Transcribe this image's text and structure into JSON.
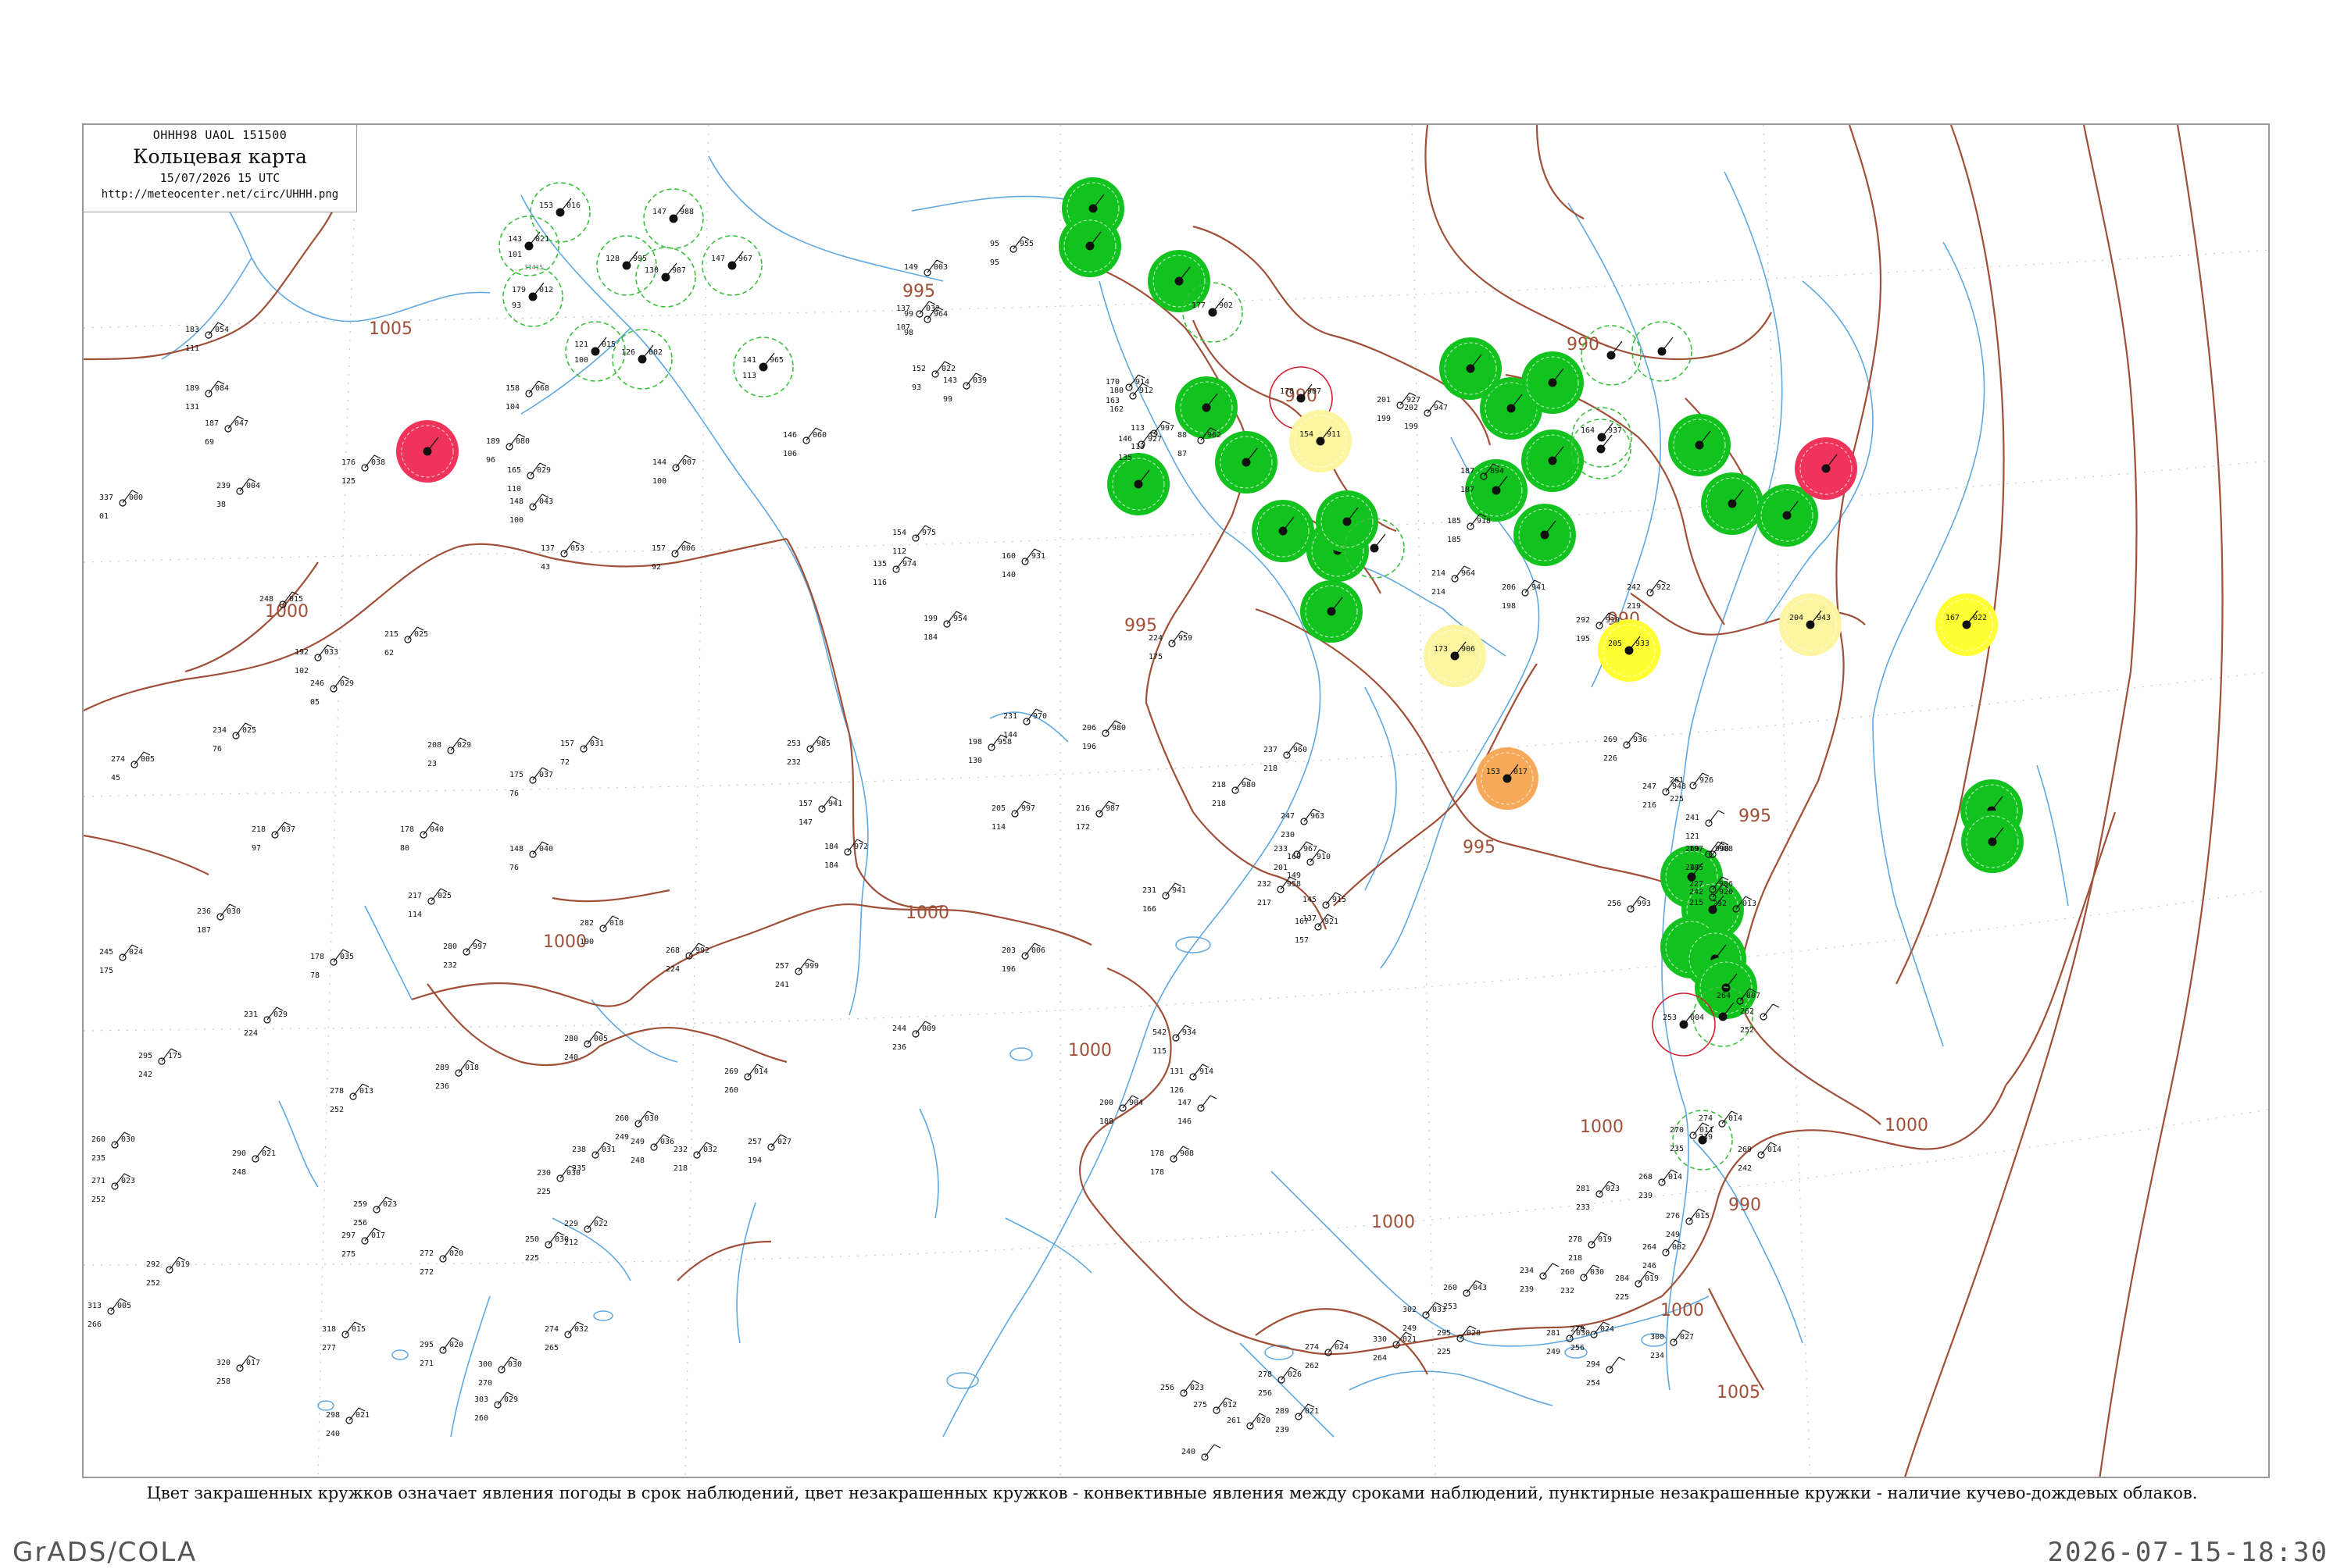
{
  "header": {
    "code": "OHHH98 UAOL 151500",
    "title": "Кольцевая карта",
    "date": "15/07/2026 15 UTC",
    "url": "http://meteocenter.net/circ/UHHH.png"
  },
  "caption": "Цвет закрашенных кружков означает явления погоды в срок наблюдений, цвет незакрашенных кружков - конвективные явления между сроками наблюдений, пунктирные незакрашенные кружки - наличие кучево-дождевых облаков.",
  "footer": {
    "left": "GrADS/COLA",
    "right": "2026-07-15-18:30"
  },
  "colors": {
    "isobar": "#a05038",
    "river": "#5fa8e0",
    "green": "#12c21e",
    "red": "#f0335a",
    "yellow": "#ffff33",
    "light_yellow": "#fdf5a0",
    "orange": "#f7a95a",
    "green_dashed": "#3cbf3c",
    "red_ring": "#d02030"
  },
  "isobar_labels": [
    {
      "text": "1005"
    },
    {
      "text": "1000"
    },
    {
      "text": "1000"
    },
    {
      "text": "1000"
    },
    {
      "text": "1000"
    },
    {
      "text": "1000"
    },
    {
      "text": "1000"
    },
    {
      "text": "995"
    },
    {
      "text": "995"
    },
    {
      "text": "995"
    },
    {
      "text": "995"
    },
    {
      "text": "990"
    },
    {
      "text": "990"
    },
    {
      "text": "990"
    },
    {
      "text": "990"
    },
    {
      "text": "1000"
    },
    {
      "text": "1005"
    },
    {
      "text": "1000"
    }
  ],
  "stations": [
    {
      "t": "143",
      "p": "021",
      "td": "101",
      "id": "31415",
      "kind": "dashed"
    },
    {
      "t": "153",
      "p": "016",
      "td": "",
      "id": "",
      "kind": "dashed"
    },
    {
      "t": "179",
      "p": "012",
      "td": "93",
      "id": "",
      "kind": "dashed"
    },
    {
      "t": "121",
      "p": "015",
      "td": "100",
      "id": "",
      "kind": "dashed"
    },
    {
      "t": "128",
      "p": "995",
      "td": "",
      "id": "",
      "kind": "dashed"
    },
    {
      "t": "147",
      "p": "988",
      "td": "",
      "id": "",
      "kind": "dashed"
    },
    {
      "t": "130",
      "p": "987",
      "td": "",
      "id": "",
      "kind": "dashed"
    },
    {
      "t": "147",
      "p": "967",
      "td": "",
      "id": "",
      "kind": "dashed"
    },
    {
      "t": "126",
      "p": "002",
      "td": "",
      "id": "",
      "kind": "dashed"
    },
    {
      "t": "141",
      "p": "965",
      "td": "113",
      "id": "",
      "kind": "dashed"
    },
    {
      "t": "",
      "p": "",
      "td": "",
      "id": "",
      "kind": "red"
    },
    {
      "t": "",
      "p": "",
      "td": "",
      "id": "",
      "kind": "green"
    },
    {
      "t": "",
      "p": "",
      "td": "",
      "id": "",
      "kind": "green"
    },
    {
      "t": "",
      "p": "",
      "td": "",
      "id": "",
      "kind": "green"
    },
    {
      "t": "",
      "p": "",
      "td": "",
      "id": "",
      "kind": "green"
    },
    {
      "t": "",
      "p": "",
      "td": "",
      "id": "",
      "kind": "green"
    },
    {
      "t": "177",
      "p": "902",
      "td": "",
      "id": "",
      "kind": "dashed"
    },
    {
      "t": "178",
      "p": "907",
      "td": "",
      "id": "",
      "kind": "redring"
    },
    {
      "t": "154",
      "p": "911",
      "td": "",
      "id": "",
      "kind": "lightyellow"
    },
    {
      "t": "",
      "p": "",
      "td": "",
      "id": "",
      "kind": "green"
    },
    {
      "t": "",
      "p": "",
      "td": "",
      "id": "",
      "kind": "green"
    },
    {
      "t": "",
      "p": "",
      "td": "",
      "id": "",
      "kind": "green"
    },
    {
      "t": "",
      "p": "",
      "td": "",
      "id": "",
      "kind": "green"
    },
    {
      "t": "",
      "p": "",
      "td": "",
      "id": "",
      "kind": "green"
    },
    {
      "t": "",
      "p": "",
      "td": "",
      "id": "",
      "kind": "green"
    },
    {
      "t": "",
      "p": "",
      "td": "",
      "id": "",
      "kind": "green"
    },
    {
      "t": "",
      "p": "",
      "td": "",
      "id": "",
      "kind": "green"
    },
    {
      "t": "",
      "p": "",
      "td": "",
      "id": "",
      "kind": "green"
    },
    {
      "t": "",
      "p": "",
      "td": "",
      "id": "",
      "kind": "green"
    },
    {
      "t": "",
      "p": "",
      "td": "",
      "id": "",
      "kind": "green"
    },
    {
      "t": "",
      "p": "",
      "td": "",
      "id": "",
      "kind": "green"
    },
    {
      "t": "",
      "p": "",
      "td": "",
      "id": "",
      "kind": "green"
    },
    {
      "t": "",
      "p": "",
      "td": "",
      "id": "",
      "kind": "red"
    },
    {
      "t": "173",
      "p": "906",
      "td": "",
      "id": "",
      "kind": "lightyellow"
    },
    {
      "t": "204",
      "p": "943",
      "td": "",
      "id": "",
      "kind": "lightyellow"
    },
    {
      "t": "205",
      "p": "933",
      "td": "",
      "id": "",
      "kind": "yellow"
    },
    {
      "t": "167",
      "p": "022",
      "td": "",
      "id": "",
      "kind": "yellow"
    },
    {
      "t": "153",
      "p": "017",
      "td": "",
      "id": "",
      "kind": "orange"
    },
    {
      "t": "",
      "p": "",
      "td": "",
      "id": "",
      "kind": "green"
    },
    {
      "t": "",
      "p": "",
      "td": "",
      "id": "",
      "kind": "green"
    },
    {
      "t": "",
      "p": "",
      "td": "",
      "id": "",
      "kind": "green"
    },
    {
      "t": "",
      "p": "",
      "td": "",
      "id": "",
      "kind": "green"
    },
    {
      "t": "",
      "p": "",
      "td": "",
      "id": "",
      "kind": "green"
    },
    {
      "t": "",
      "p": "",
      "td": "",
      "id": "",
      "kind": "green"
    },
    {
      "t": "",
      "p": "",
      "td": "",
      "id": "",
      "kind": "green"
    },
    {
      "t": "253",
      "p": "004",
      "td": "",
      "id": "",
      "kind": "redring"
    },
    {
      "t": "",
      "p": "",
      "td": "",
      "id": "",
      "kind": "dashed"
    },
    {
      "t": "",
      "p": "",
      "td": "",
      "id": "",
      "kind": "dashed"
    },
    {
      "t": "",
      "p": "",
      "td": "",
      "id": "",
      "kind": "dashed"
    },
    {
      "t": "",
      "p": "",
      "td": "",
      "id": "",
      "kind": "dashed"
    },
    {
      "t": "",
      "p": "",
      "td": "",
      "id": "",
      "kind": "dashed"
    },
    {
      "t": "164",
      "p": "937",
      "td": "",
      "id": "",
      "kind": "dashed"
    },
    {
      "t": "",
      "p": "",
      "td": "",
      "id": "",
      "kind": "dashed"
    },
    {
      "t": "",
      "p": "",
      "td": "",
      "id": "",
      "kind": "green"
    }
  ],
  "plain_stations": [
    {
      "t": "183",
      "p": "054",
      "td": "111"
    },
    {
      "t": "189",
      "p": "084",
      "td": "131"
    },
    {
      "t": "187",
      "p": "047",
      "td": "69"
    },
    {
      "t": "239",
      "p": "004",
      "td": "38"
    },
    {
      "t": "337",
      "p": "000",
      "td": "01"
    },
    {
      "t": "176",
      "p": "038",
      "td": "125"
    },
    {
      "t": "248",
      "p": "015",
      "td": ""
    },
    {
      "t": "246",
      "p": "029",
      "td": "05"
    },
    {
      "t": "274",
      "p": "005",
      "td": "45"
    },
    {
      "t": "234",
      "p": "025",
      "td": "76"
    },
    {
      "t": "218",
      "p": "037",
      "td": "97"
    },
    {
      "t": "236",
      "p": "030",
      "td": "187"
    },
    {
      "t": "245",
      "p": "024",
      "td": "175"
    },
    {
      "t": "178",
      "p": "035",
      "td": "78"
    },
    {
      "t": "231",
      "p": "029",
      "td": "224"
    },
    {
      "t": "295",
      "p": "175",
      "td": "242"
    },
    {
      "t": "278",
      "p": "013",
      "td": "252"
    },
    {
      "t": "260",
      "p": "030",
      "td": "235"
    },
    {
      "t": "290",
      "p": "021",
      "td": "248"
    },
    {
      "t": "271",
      "p": "023",
      "td": "252"
    },
    {
      "t": "297",
      "p": "017",
      "td": "275"
    },
    {
      "t": "292",
      "p": "019",
      "td": "252"
    },
    {
      "t": "313",
      "p": "005",
      "td": "266"
    },
    {
      "t": "318",
      "p": "015",
      "td": "277"
    },
    {
      "t": "320",
      "p": "017",
      "td": "258"
    },
    {
      "t": "298",
      "p": "021",
      "td": "240"
    },
    {
      "t": "259",
      "p": "023",
      "td": "256"
    },
    {
      "t": "272",
      "p": "020",
      "td": "272"
    },
    {
      "t": "295",
      "p": "020",
      "td": "271"
    },
    {
      "t": "303",
      "p": "029",
      "td": "260"
    },
    {
      "t": "300",
      "p": "030",
      "td": "270"
    },
    {
      "t": "274",
      "p": "032",
      "td": "265"
    },
    {
      "t": "250",
      "p": "030",
      "td": "225"
    },
    {
      "t": "229",
      "p": "022",
      "td": "212"
    },
    {
      "t": "230",
      "p": "030",
      "td": "225"
    },
    {
      "t": "238",
      "p": "031",
      "td": "235"
    },
    {
      "t": "249",
      "p": "036",
      "td": "248"
    },
    {
      "t": "260",
      "p": "030",
      "td": "249"
    },
    {
      "t": "232",
      "p": "032",
      "td": "218"
    },
    {
      "t": "257",
      "p": "027",
      "td": "194"
    },
    {
      "t": "269",
      "p": "014",
      "td": "260"
    },
    {
      "t": "244",
      "p": "009",
      "td": "236"
    },
    {
      "t": "289",
      "p": "018",
      "td": "236"
    },
    {
      "t": "280",
      "p": "005",
      "td": "240"
    },
    {
      "t": "280",
      "p": "997",
      "td": "232"
    },
    {
      "t": "268",
      "p": "992",
      "td": "224"
    },
    {
      "t": "257",
      "p": "999",
      "td": "241"
    },
    {
      "t": "203",
      "p": "006",
      "td": "196"
    },
    {
      "t": "217",
      "p": "025",
      "td": "114"
    },
    {
      "t": "282",
      "p": "018",
      "td": "190"
    },
    {
      "t": "178",
      "p": "040",
      "td": "80"
    },
    {
      "t": "148",
      "p": "040",
      "td": "76"
    },
    {
      "t": "175",
      "p": "037",
      "td": "76"
    },
    {
      "t": "208",
      "p": "029",
      "td": "23"
    },
    {
      "t": "157",
      "p": "031",
      "td": "72"
    },
    {
      "t": "215",
      "p": "025",
      "td": "62"
    },
    {
      "t": "192",
      "p": "033",
      "td": "102"
    },
    {
      "t": "137",
      "p": "053",
      "td": "43"
    },
    {
      "t": "165",
      "p": "029",
      "td": "110"
    },
    {
      "t": "144",
      "p": "007",
      "td": "100"
    },
    {
      "t": "157",
      "p": "006",
      "td": "92"
    },
    {
      "t": "154",
      "p": "975",
      "td": "112"
    },
    {
      "t": "135",
      "p": "974",
      "td": "116"
    },
    {
      "t": "160",
      "p": "931",
      "td": "140"
    },
    {
      "t": "199",
      "p": "954",
      "td": "184"
    },
    {
      "t": "231",
      "p": "970",
      "td": "144"
    },
    {
      "t": "198",
      "p": "958",
      "td": "130"
    },
    {
      "t": "206",
      "p": "980",
      "td": "196"
    },
    {
      "t": "205",
      "p": "997",
      "td": "114"
    },
    {
      "t": "216",
      "p": "987",
      "td": "172"
    },
    {
      "t": "253",
      "p": "985",
      "td": "232"
    },
    {
      "t": "157",
      "p": "941",
      "td": "147"
    },
    {
      "t": "184",
      "p": "972",
      "td": "184"
    },
    {
      "t": "224",
      "p": "959",
      "td": "175"
    },
    {
      "t": "218",
      "p": "980",
      "td": "218"
    },
    {
      "t": "237",
      "p": "960",
      "td": "218"
    },
    {
      "t": "231",
      "p": "941",
      "td": "166"
    },
    {
      "t": "232",
      "p": "958",
      "td": "217"
    },
    {
      "t": "247",
      "p": "963",
      "td": "230"
    },
    {
      "t": "233",
      "p": "967",
      "td": "201"
    },
    {
      "t": "145",
      "p": "915",
      "td": "137"
    },
    {
      "t": "160",
      "p": "910",
      "td": "149"
    },
    {
      "t": "167",
      "p": "921",
      "td": "157"
    },
    {
      "t": "170",
      "p": "914",
      "td": "163"
    },
    {
      "t": "180",
      "p": "912",
      "td": "162"
    },
    {
      "t": "146",
      "p": "927",
      "td": "135"
    },
    {
      "t": "113",
      "p": "997",
      "td": "113"
    },
    {
      "t": "88",
      "p": "962",
      "td": "87"
    },
    {
      "t": "95",
      "p": "955",
      "td": "95"
    },
    {
      "t": "99",
      "p": "964",
      "td": "98"
    },
    {
      "t": "149",
      "p": "003",
      "td": ""
    },
    {
      "t": "152",
      "p": "022",
      "td": "93"
    },
    {
      "t": "143",
      "p": "039",
      "td": "99"
    },
    {
      "t": "137",
      "p": "032",
      "td": "107"
    },
    {
      "t": "146",
      "p": "060",
      "td": "106"
    },
    {
      "t": "158",
      "p": "068",
      "td": "104"
    },
    {
      "t": "189",
      "p": "080",
      "td": "96"
    },
    {
      "t": "148",
      "p": "043",
      "td": "100"
    },
    {
      "t": "542",
      "p": "934",
      "td": "115"
    },
    {
      "t": "131",
      "p": "914",
      "td": "126"
    },
    {
      "t": "147",
      "p": "",
      "td": "146"
    },
    {
      "t": "200",
      "p": "904",
      "td": "188"
    },
    {
      "t": "178",
      "p": "908",
      "td": "178"
    },
    {
      "t": "201",
      "p": "927",
      "td": "199"
    },
    {
      "t": "202",
      "p": "947",
      "td": "199"
    },
    {
      "t": "187",
      "p": "894",
      "td": "187"
    },
    {
      "t": "185",
      "p": "918",
      "td": "185"
    },
    {
      "t": "214",
      "p": "964",
      "td": "214"
    },
    {
      "t": "206",
      "p": "941",
      "td": "198"
    },
    {
      "t": "292",
      "p": "919",
      "td": "195"
    },
    {
      "t": "242",
      "p": "922",
      "td": "219"
    },
    {
      "t": "269",
      "p": "936",
      "td": "226"
    },
    {
      "t": "247",
      "p": "948",
      "td": "216"
    },
    {
      "t": "261",
      "p": "926",
      "td": "225"
    },
    {
      "t": "241",
      "p": "",
      "td": "121"
    },
    {
      "t": "227",
      "p": "986",
      "td": "215"
    },
    {
      "t": "197",
      "p": "988",
      "td": "185"
    },
    {
      "t": "242",
      "p": "920",
      "td": ""
    },
    {
      "t": "269",
      "p": "990",
      "td": "247"
    },
    {
      "t": "256",
      "p": "993",
      "td": ""
    },
    {
      "t": "292",
      "p": "013",
      "td": ""
    },
    {
      "t": "264",
      "p": "007",
      "td": ""
    },
    {
      "t": "262",
      "p": "",
      "td": "252"
    },
    {
      "t": "274",
      "p": "014",
      "td": "239"
    },
    {
      "t": "270",
      "p": "011",
      "td": "235"
    },
    {
      "t": "269",
      "p": "014",
      "td": "242"
    },
    {
      "t": "268",
      "p": "014",
      "td": "239"
    },
    {
      "t": "264",
      "p": "002",
      "td": "246"
    },
    {
      "t": "276",
      "p": "015",
      "td": "249"
    },
    {
      "t": "281",
      "p": "023",
      "td": "233"
    },
    {
      "t": "278",
      "p": "019",
      "td": "218"
    },
    {
      "t": "260",
      "p": "030",
      "td": "232"
    },
    {
      "t": "284",
      "p": "019",
      "td": "225"
    },
    {
      "t": "278",
      "p": "024",
      "td": "256"
    },
    {
      "t": "300",
      "p": "027",
      "td": "234"
    },
    {
      "t": "234",
      "p": "",
      "td": "239"
    },
    {
      "t": "281",
      "p": "030",
      "td": "249"
    },
    {
      "t": "294",
      "p": "",
      "td": "254"
    },
    {
      "t": "260",
      "p": "043",
      "td": "253"
    },
    {
      "t": "302",
      "p": "033",
      "td": "249"
    },
    {
      "t": "295",
      "p": "028",
      "td": "225"
    },
    {
      "t": "330",
      "p": "021",
      "td": "264"
    },
    {
      "t": "274",
      "p": "024",
      "td": "262"
    },
    {
      "t": "278",
      "p": "026",
      "td": "256"
    },
    {
      "t": "289",
      "p": "021",
      "td": "239"
    },
    {
      "t": "261",
      "p": "020",
      "td": ""
    },
    {
      "t": "256",
      "p": "023",
      "td": ""
    },
    {
      "t": "275",
      "p": "012",
      "td": ""
    },
    {
      "t": "240",
      "p": "",
      "td": ""
    }
  ]
}
